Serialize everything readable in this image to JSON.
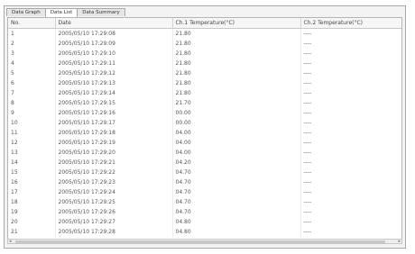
{
  "tabs": [
    {
      "label": "Data Graph"
    },
    {
      "label": "Data List"
    },
    {
      "label": "Data Summary"
    }
  ],
  "table": {
    "columns": [
      "No.",
      "Date",
      "Ch.1 Temperature(°C)",
      "Ch.2 Temperature(°C)"
    ],
    "rows": [
      [
        "1",
        "2005/05/10 17:29:08",
        "21.80",
        "----"
      ],
      [
        "2",
        "2005/05/10 17:29:09",
        "21.80",
        "----"
      ],
      [
        "3",
        "2005/05/10 17:29:10",
        "21.80",
        "----"
      ],
      [
        "4",
        "2005/05/10 17:29:11",
        "21.80",
        "----"
      ],
      [
        "5",
        "2005/05/10 17:29:12",
        "21.80",
        "----"
      ],
      [
        "6",
        "2005/05/10 17:29:13",
        "21.80",
        "----"
      ],
      [
        "7",
        "2005/05/10 17:29:14",
        "21.80",
        "----"
      ],
      [
        "8",
        "2005/05/10 17:29:15",
        "21.70",
        "----"
      ],
      [
        "9",
        "2005/05/10 17:29:16",
        "00.00",
        "----"
      ],
      [
        "10",
        "2005/05/10 17:29:17",
        "00.00",
        "----"
      ],
      [
        "11",
        "2005/05/10 17:29:18",
        "04.00",
        "----"
      ],
      [
        "12",
        "2005/05/10 17:29:19",
        "04.00",
        "----"
      ],
      [
        "13",
        "2005/05/10 17:29:20",
        "04.00",
        "----"
      ],
      [
        "14",
        "2005/05/10 17:29:21",
        "04.20",
        "----"
      ],
      [
        "15",
        "2005/05/10 17:29:22",
        "04.70",
        "----"
      ],
      [
        "16",
        "2005/05/10 17:29:23",
        "04.70",
        "----"
      ],
      [
        "17",
        "2005/05/10 17:29:24",
        "04.70",
        "----"
      ],
      [
        "18",
        "2005/05/10 17:29:25",
        "04.70",
        "----"
      ],
      [
        "19",
        "2005/05/10 17:29:26",
        "04.70",
        "----"
      ],
      [
        "20",
        "2005/05/10 17:29:27",
        "04.80",
        "----"
      ],
      [
        "21",
        "2005/05/10 17:29:28",
        "04.80",
        "----"
      ]
    ]
  }
}
